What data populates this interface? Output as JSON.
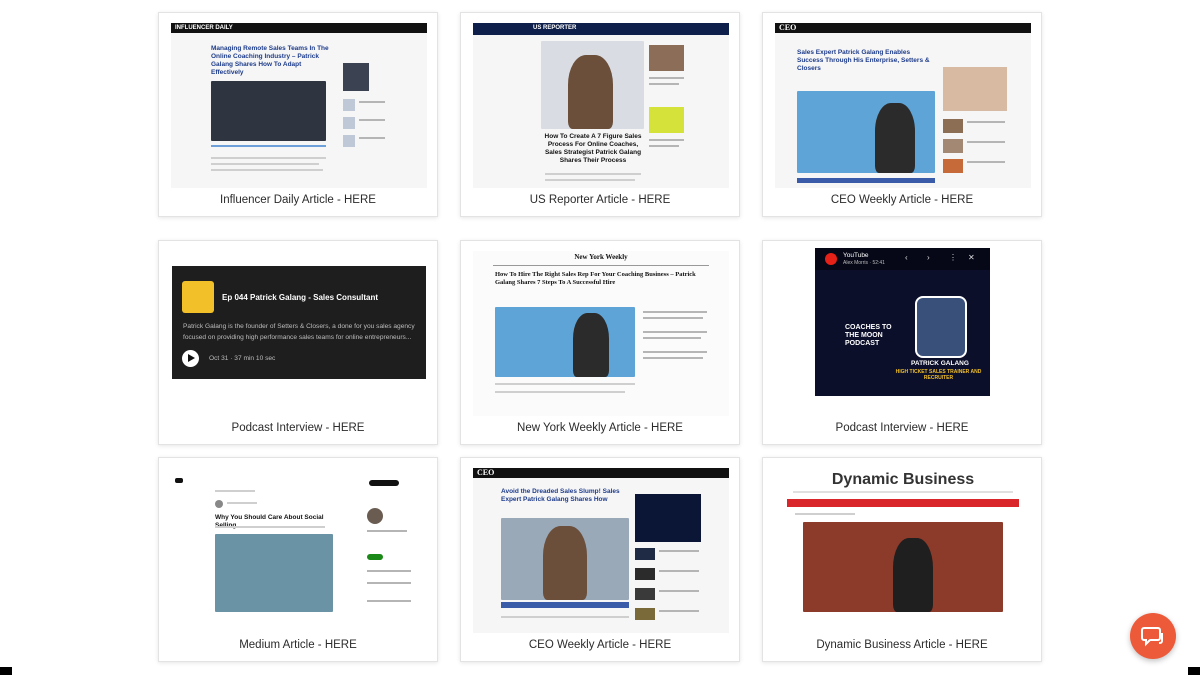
{
  "cards": [
    {
      "caption": "Influencer Daily Article - HERE",
      "masthead": "INFLUENCER DAILY",
      "headline": "Managing Remote Sales Teams In The Online Coaching Industry – Patrick Galang Shares How To Adapt Effectively"
    },
    {
      "caption": "US Reporter Article - HERE",
      "masthead": "US REPORTER",
      "headline": "How To Create A 7 Figure Sales Process For Online Coaches, Sales Strategist Patrick Galang Shares Their Process"
    },
    {
      "caption": "CEO Weekly Article - HERE",
      "masthead": "CEO",
      "headline": "Sales Expert Patrick Galang Enables Success Through His Enterprise, Setters & Closers"
    },
    {
      "caption": "Podcast Interview - HERE",
      "episode_title": "Ep 044 Patrick Galang - Sales Consultant",
      "description": "Patrick Galang is the founder of Setters & Closers, a done for you sales agency focused on providing high performance sales teams for online entrepreneurs...",
      "meta": "Oct 31 · 37 min 10 sec"
    },
    {
      "caption": "New York Weekly Article - HERE",
      "masthead": "New York Weekly",
      "headline": "How To Hire The Right Sales Rep For Your Coaching Business – Patrick Galang Shares 7 Steps To A Successful Hire"
    },
    {
      "caption": "Podcast Interview - HERE",
      "yt_label": "YouTube",
      "yt_channel": "Alex Morris · 52:41",
      "show": "COACHES TO THE MOON PODCAST",
      "guest": "PATRICK GALANG",
      "role": "HIGH TICKET SALES TRAINER AND RECRUITER"
    },
    {
      "caption": "Medium Article - HERE",
      "headline": "Why You Should Care About Social Selling"
    },
    {
      "caption": "CEO Weekly Article - HERE",
      "masthead": "CEO",
      "headline": "Avoid the Dreaded Sales Slump! Sales Expert Patrick Galang Shares How"
    },
    {
      "caption": "Dynamic Business Article - HERE",
      "masthead": "Dynamic Business"
    }
  ]
}
